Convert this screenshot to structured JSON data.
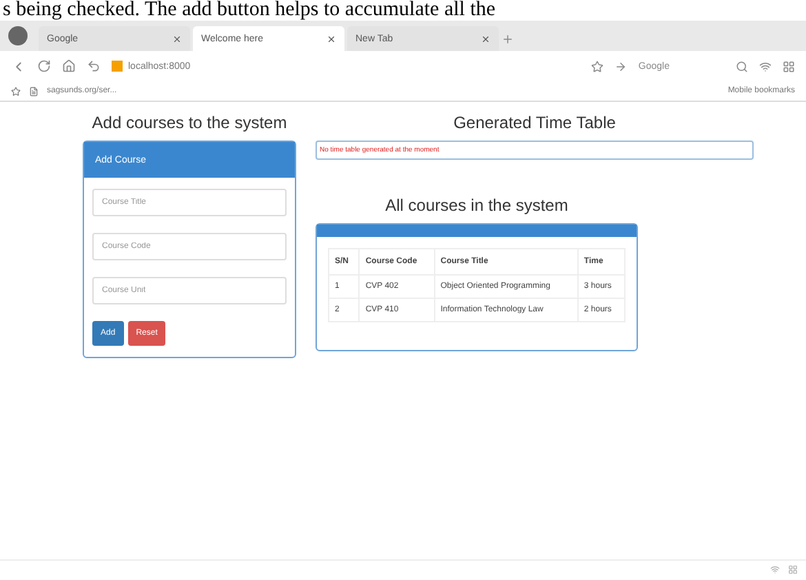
{
  "document_text": "s being checked. The add button helps to accumulate all the",
  "browser": {
    "tabs": [
      {
        "label": "Google",
        "selected": false
      },
      {
        "label": "Welcome here",
        "selected": true
      },
      {
        "label": "New Tab",
        "selected": false
      }
    ],
    "address": "localhost:8000",
    "search_engine": "Google",
    "bookmark": "sagsunds.org/ser...",
    "mobile_bookmarks": "Mobile bookmarks"
  },
  "add_course": {
    "heading": "Add courses to the system",
    "panel_title": "Add Course",
    "fields": [
      {
        "placeholder": "Course Title"
      },
      {
        "placeholder": "Course Code"
      },
      {
        "placeholder": "Course Unit"
      }
    ],
    "buttons": [
      {
        "label": "Add",
        "kind": "primary"
      },
      {
        "label": "Reset",
        "kind": "danger"
      }
    ]
  },
  "timetable": {
    "heading": "Generated Time Table",
    "message": "No time table generated at the moment"
  },
  "courses": {
    "heading": "All courses in the system",
    "columns": [
      "S/N",
      "Course Code",
      "Course Title",
      "Time"
    ],
    "rows": [
      [
        "1",
        "CVP 402",
        "Object Oriented Programming",
        "3 hours"
      ],
      [
        "2",
        "CVP 410",
        "Information Technology Law",
        "2 hours"
      ]
    ]
  }
}
